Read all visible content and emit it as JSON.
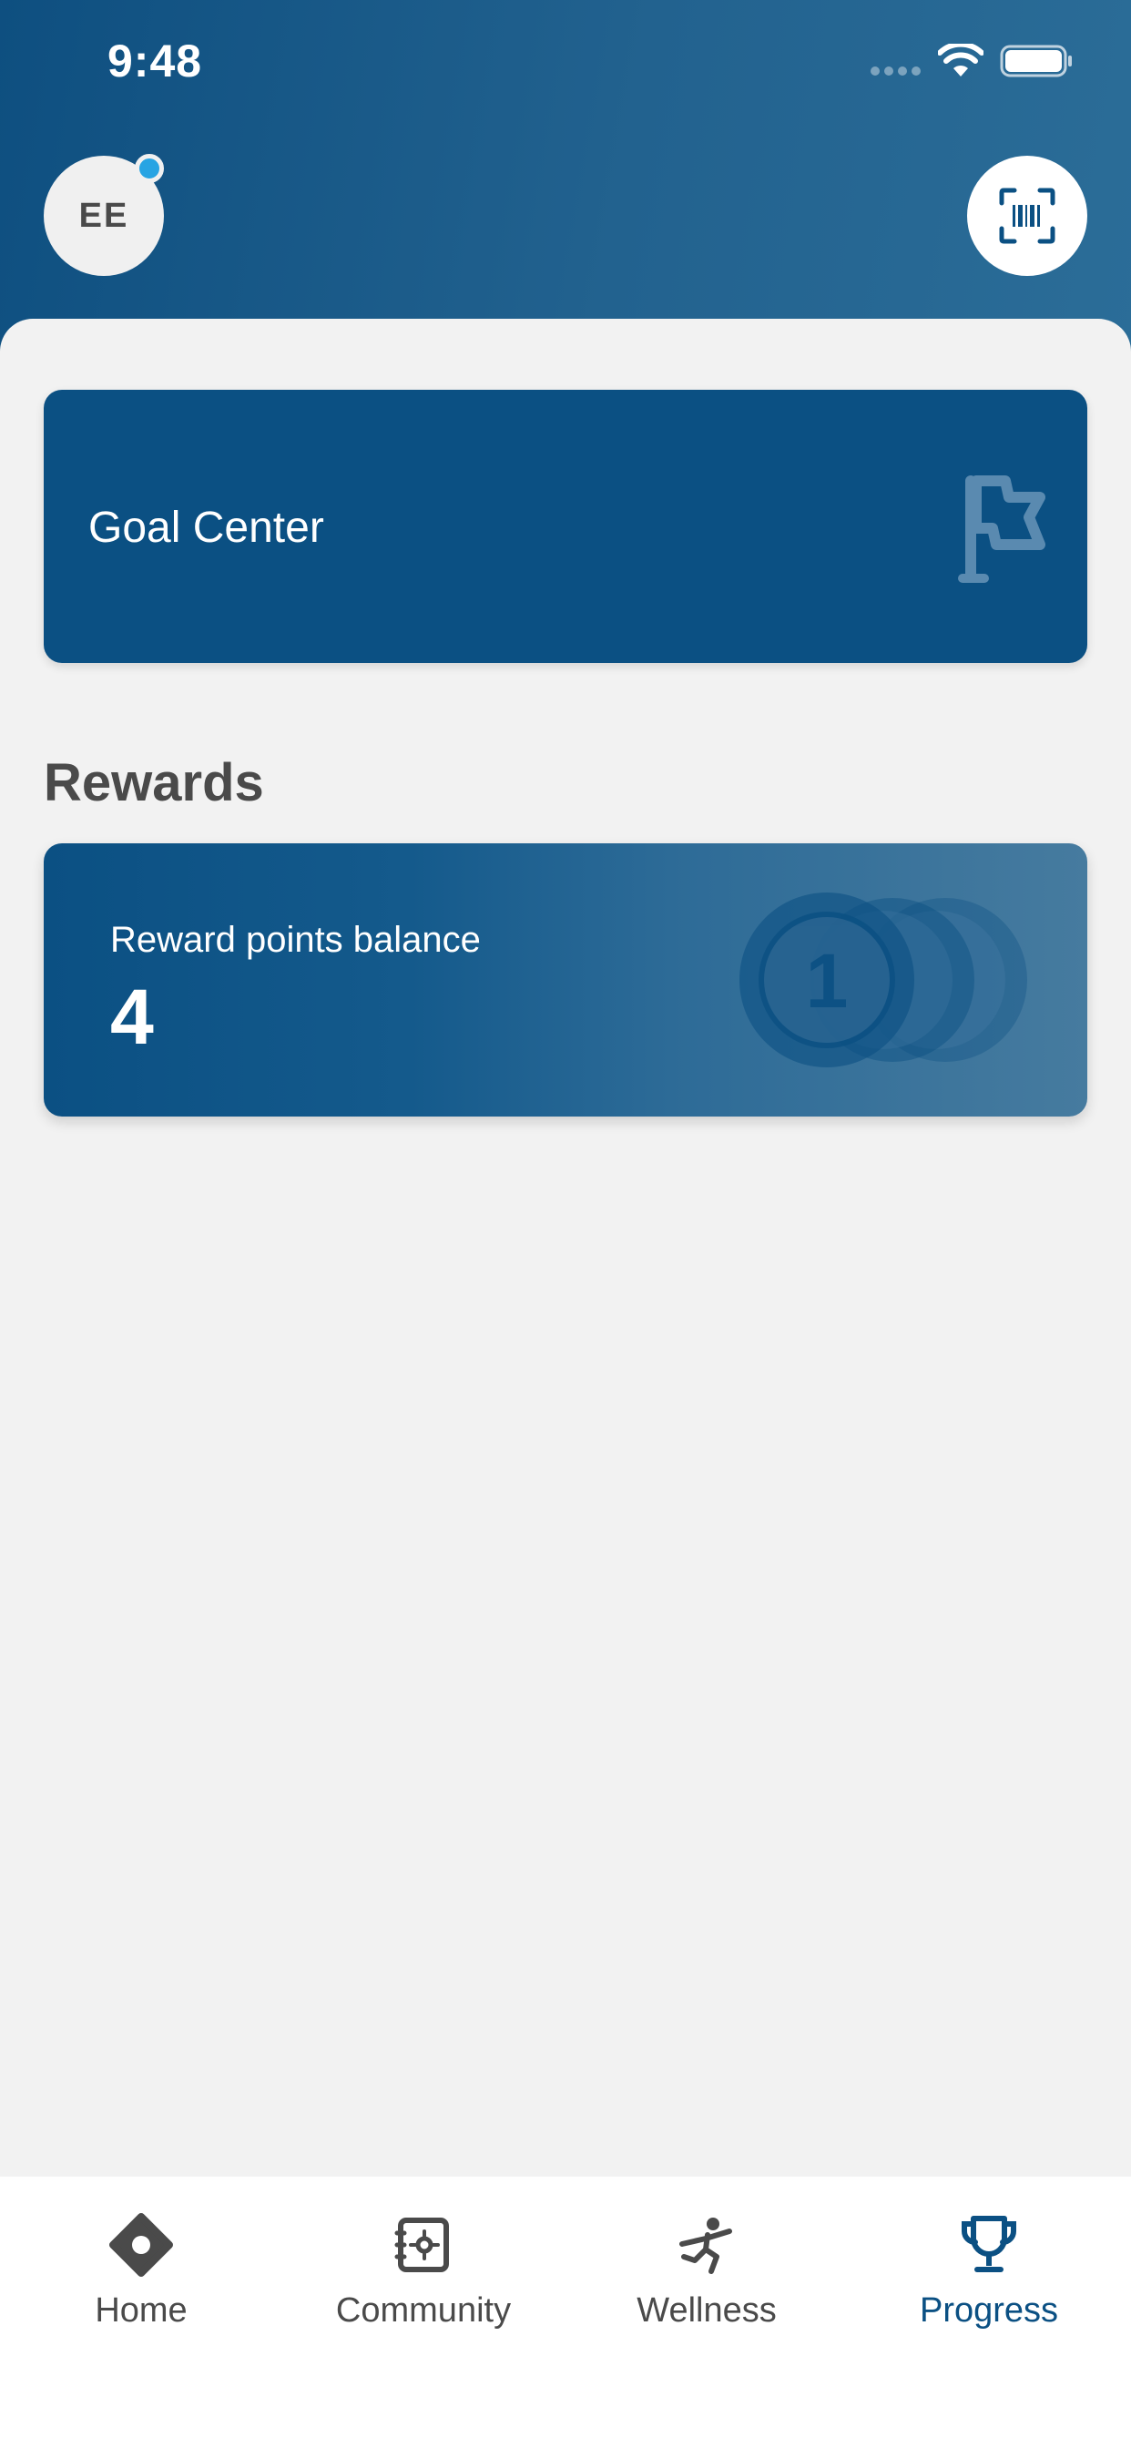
{
  "status_bar": {
    "time": "9:48"
  },
  "header": {
    "avatar_initials": "EE"
  },
  "goal_card": {
    "title": "Goal Center"
  },
  "rewards": {
    "heading": "Rewards",
    "balance_label": "Reward points balance",
    "balance_value": "4",
    "coin_glyph": "1"
  },
  "tabs": [
    {
      "label": "Home",
      "icon": "home-icon",
      "active": false
    },
    {
      "label": "Community",
      "icon": "community-icon",
      "active": false
    },
    {
      "label": "Wellness",
      "icon": "wellness-icon",
      "active": false
    },
    {
      "label": "Progress",
      "icon": "trophy-icon",
      "active": true
    }
  ],
  "colors": {
    "brand": "#0b5083",
    "header_gradient_end": "#2b6d98",
    "notification": "#27a4e3",
    "active_tab": "#0b5083",
    "inactive_tab": "#4a4a4a"
  }
}
